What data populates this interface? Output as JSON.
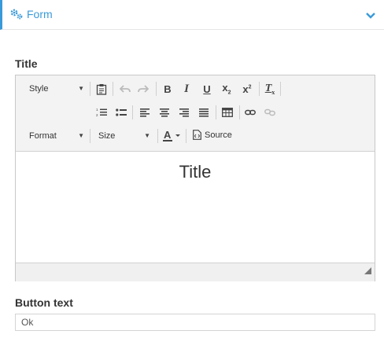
{
  "panel": {
    "title": "Form",
    "icon": "gears-icon",
    "toggle_icon": "chevron-down-icon",
    "accent": "#3a9ad9"
  },
  "title_field": {
    "label": "Title",
    "toolbar": {
      "style_label": "Style",
      "format_label": "Format",
      "size_label": "Size",
      "source_label": "Source"
    },
    "content": "Title"
  },
  "button_text_field": {
    "label": "Button text",
    "value": "Ok"
  }
}
